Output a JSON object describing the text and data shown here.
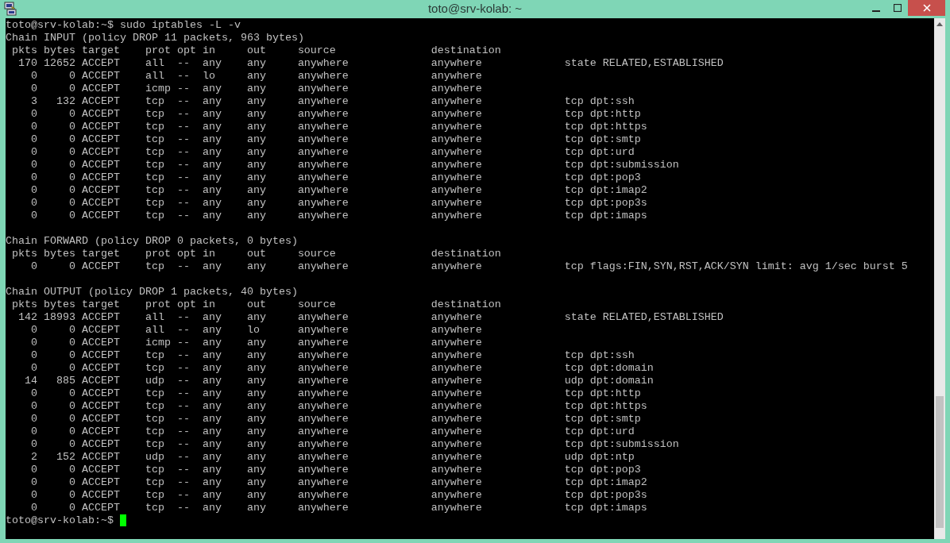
{
  "window": {
    "title": "toto@srv-kolab: ~"
  },
  "terminal": {
    "command_line": {
      "prompt": "toto@srv-kolab:~$",
      "command": "sudo iptables -L -v"
    },
    "chains": [
      {
        "header": "Chain INPUT (policy DROP 11 packets, 963 bytes)",
        "columns": [
          "pkts",
          "bytes",
          "target",
          "prot",
          "opt",
          "in",
          "out",
          "source",
          "destination"
        ],
        "rows": [
          [
            "170",
            "12652",
            "ACCEPT",
            "all",
            "--",
            "any",
            "any",
            "anywhere",
            "anywhere",
            "state RELATED,ESTABLISHED"
          ],
          [
            "0",
            "0",
            "ACCEPT",
            "all",
            "--",
            "lo",
            "any",
            "anywhere",
            "anywhere"
          ],
          [
            "0",
            "0",
            "ACCEPT",
            "icmp",
            "--",
            "any",
            "any",
            "anywhere",
            "anywhere"
          ],
          [
            "3",
            "132",
            "ACCEPT",
            "tcp",
            "--",
            "any",
            "any",
            "anywhere",
            "anywhere",
            "tcp dpt:ssh"
          ],
          [
            "0",
            "0",
            "ACCEPT",
            "tcp",
            "--",
            "any",
            "any",
            "anywhere",
            "anywhere",
            "tcp dpt:http"
          ],
          [
            "0",
            "0",
            "ACCEPT",
            "tcp",
            "--",
            "any",
            "any",
            "anywhere",
            "anywhere",
            "tcp dpt:https"
          ],
          [
            "0",
            "0",
            "ACCEPT",
            "tcp",
            "--",
            "any",
            "any",
            "anywhere",
            "anywhere",
            "tcp dpt:smtp"
          ],
          [
            "0",
            "0",
            "ACCEPT",
            "tcp",
            "--",
            "any",
            "any",
            "anywhere",
            "anywhere",
            "tcp dpt:urd"
          ],
          [
            "0",
            "0",
            "ACCEPT",
            "tcp",
            "--",
            "any",
            "any",
            "anywhere",
            "anywhere",
            "tcp dpt:submission"
          ],
          [
            "0",
            "0",
            "ACCEPT",
            "tcp",
            "--",
            "any",
            "any",
            "anywhere",
            "anywhere",
            "tcp dpt:pop3"
          ],
          [
            "0",
            "0",
            "ACCEPT",
            "tcp",
            "--",
            "any",
            "any",
            "anywhere",
            "anywhere",
            "tcp dpt:imap2"
          ],
          [
            "0",
            "0",
            "ACCEPT",
            "tcp",
            "--",
            "any",
            "any",
            "anywhere",
            "anywhere",
            "tcp dpt:pop3s"
          ],
          [
            "0",
            "0",
            "ACCEPT",
            "tcp",
            "--",
            "any",
            "any",
            "anywhere",
            "anywhere",
            "tcp dpt:imaps"
          ]
        ]
      },
      {
        "header": "Chain FORWARD (policy DROP 0 packets, 0 bytes)",
        "columns": [
          "pkts",
          "bytes",
          "target",
          "prot",
          "opt",
          "in",
          "out",
          "source",
          "destination"
        ],
        "rows": [
          [
            "0",
            "0",
            "ACCEPT",
            "tcp",
            "--",
            "any",
            "any",
            "anywhere",
            "anywhere",
            "tcp flags:FIN,SYN,RST,ACK/SYN limit: avg 1/sec burst 5"
          ]
        ]
      },
      {
        "header": "Chain OUTPUT (policy DROP 1 packets, 40 bytes)",
        "columns": [
          "pkts",
          "bytes",
          "target",
          "prot",
          "opt",
          "in",
          "out",
          "source",
          "destination"
        ],
        "rows": [
          [
            "142",
            "18993",
            "ACCEPT",
            "all",
            "--",
            "any",
            "any",
            "anywhere",
            "anywhere",
            "state RELATED,ESTABLISHED"
          ],
          [
            "0",
            "0",
            "ACCEPT",
            "all",
            "--",
            "any",
            "lo",
            "anywhere",
            "anywhere"
          ],
          [
            "0",
            "0",
            "ACCEPT",
            "icmp",
            "--",
            "any",
            "any",
            "anywhere",
            "anywhere"
          ],
          [
            "0",
            "0",
            "ACCEPT",
            "tcp",
            "--",
            "any",
            "any",
            "anywhere",
            "anywhere",
            "tcp dpt:ssh"
          ],
          [
            "0",
            "0",
            "ACCEPT",
            "tcp",
            "--",
            "any",
            "any",
            "anywhere",
            "anywhere",
            "tcp dpt:domain"
          ],
          [
            "14",
            "885",
            "ACCEPT",
            "udp",
            "--",
            "any",
            "any",
            "anywhere",
            "anywhere",
            "udp dpt:domain"
          ],
          [
            "0",
            "0",
            "ACCEPT",
            "tcp",
            "--",
            "any",
            "any",
            "anywhere",
            "anywhere",
            "tcp dpt:http"
          ],
          [
            "0",
            "0",
            "ACCEPT",
            "tcp",
            "--",
            "any",
            "any",
            "anywhere",
            "anywhere",
            "tcp dpt:https"
          ],
          [
            "0",
            "0",
            "ACCEPT",
            "tcp",
            "--",
            "any",
            "any",
            "anywhere",
            "anywhere",
            "tcp dpt:smtp"
          ],
          [
            "0",
            "0",
            "ACCEPT",
            "tcp",
            "--",
            "any",
            "any",
            "anywhere",
            "anywhere",
            "tcp dpt:urd"
          ],
          [
            "0",
            "0",
            "ACCEPT",
            "tcp",
            "--",
            "any",
            "any",
            "anywhere",
            "anywhere",
            "tcp dpt:submission"
          ],
          [
            "2",
            "152",
            "ACCEPT",
            "udp",
            "--",
            "any",
            "any",
            "anywhere",
            "anywhere",
            "udp dpt:ntp"
          ],
          [
            "0",
            "0",
            "ACCEPT",
            "tcp",
            "--",
            "any",
            "any",
            "anywhere",
            "anywhere",
            "tcp dpt:pop3"
          ],
          [
            "0",
            "0",
            "ACCEPT",
            "tcp",
            "--",
            "any",
            "any",
            "anywhere",
            "anywhere",
            "tcp dpt:imap2"
          ],
          [
            "0",
            "0",
            "ACCEPT",
            "tcp",
            "--",
            "any",
            "any",
            "anywhere",
            "anywhere",
            "tcp dpt:pop3s"
          ],
          [
            "0",
            "0",
            "ACCEPT",
            "tcp",
            "--",
            "any",
            "any",
            "anywhere",
            "anywhere",
            "tcp dpt:imaps"
          ]
        ]
      }
    ],
    "prompt": "toto@srv-kolab:~$"
  }
}
